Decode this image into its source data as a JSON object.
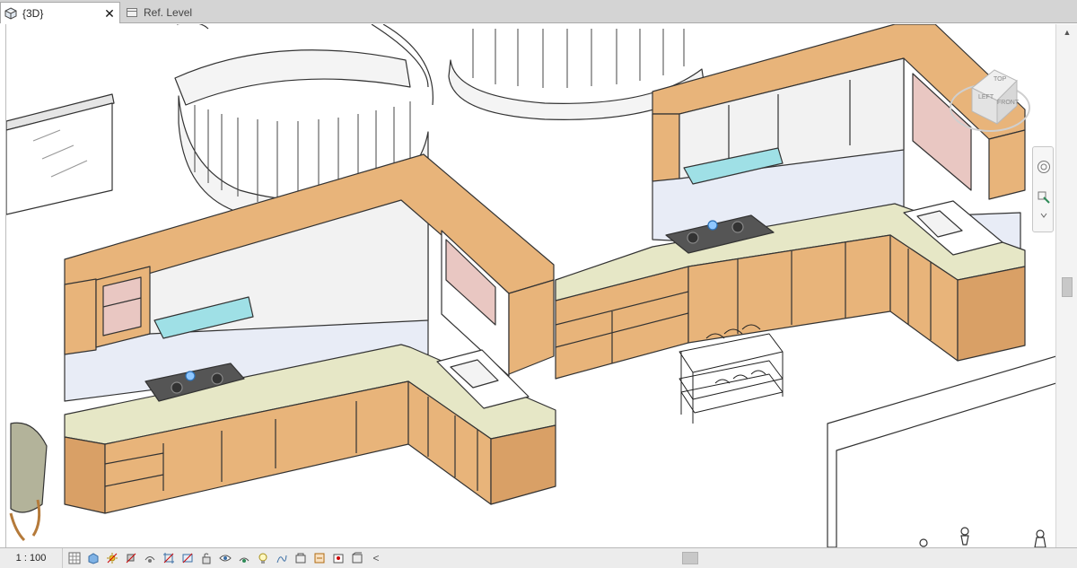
{
  "tabs": [
    {
      "label": "{3D}",
      "icon": "3d-cube-icon",
      "active": true,
      "closable": true
    },
    {
      "label": "Ref. Level",
      "icon": "plan-view-icon",
      "active": false,
      "closable": false
    }
  ],
  "viewcube": {
    "top_label": "TOP",
    "front_label": "FRONT",
    "left_label": "LEFT"
  },
  "status": {
    "scale": "1 : 100",
    "view_controls": [
      "detail-level-icon",
      "visual-style-icon",
      "sun-path-icon",
      "shadows-icon",
      "render-icon",
      "crop-view-icon",
      "show-crop-icon",
      "unlock-3d-icon",
      "temporary-hide-icon",
      "reveal-hidden-icon",
      "analysis-display-icon",
      "highlight-displacement-icon",
      "worksharing-icon",
      "reveal-constraints-icon",
      "preview-visibility-icon",
      "section-box-icon"
    ]
  },
  "colors": {
    "cabinet": "#e8b47a",
    "cabinet_dark": "#d9a066",
    "countertop": "#e6e7c6",
    "backsplash": "#e8ecf6",
    "upper_interior": "#f2f2f2",
    "glass_panel": "#e9c7c2",
    "hood": "#9fe0e6",
    "line": "#333333"
  }
}
